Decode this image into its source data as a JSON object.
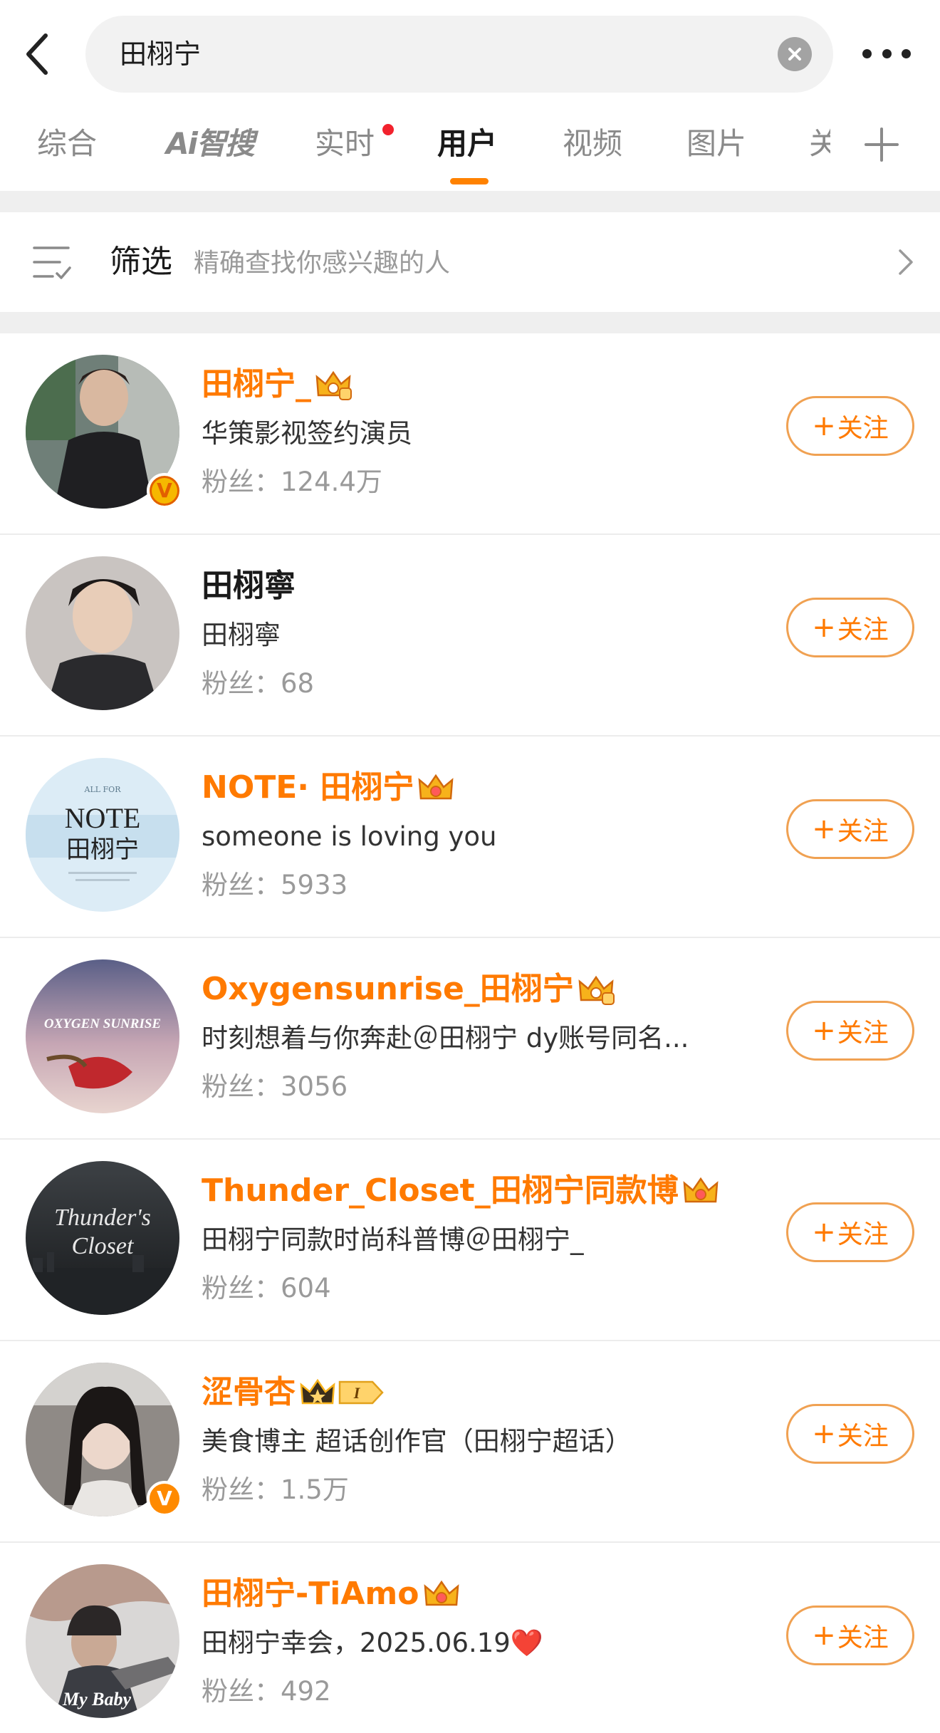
{
  "search": {
    "query": "田栩宁"
  },
  "tabs": [
    {
      "label": "综合"
    },
    {
      "label": "Ai智搜"
    },
    {
      "label": "实时"
    },
    {
      "label": "用户"
    },
    {
      "label": "视频"
    },
    {
      "label": "图片"
    },
    {
      "label": "关"
    }
  ],
  "active_tab": "用户",
  "filter": {
    "title": "筛选",
    "subtitle": "精确查找你感兴趣的人"
  },
  "follow_label": "关注",
  "fans_prefix": "粉丝：",
  "users": [
    {
      "name": "田栩宁_",
      "desc": "华策影视签约演员",
      "fans": "124.4万",
      "verified": "gold",
      "crown": true
    },
    {
      "name": "田栩寧",
      "desc": "田栩寧",
      "fans": "68",
      "verified": "none",
      "crown": false
    },
    {
      "name": "NOTE· 田栩宁",
      "desc": "someone is loving you",
      "fans": "5933",
      "verified": "none",
      "crown": true
    },
    {
      "name": "Oxygensunrise_田栩宁",
      "desc": "时刻想着与你奔赴＠田栩宁 dy账号同名...",
      "fans": "3056",
      "verified": "none",
      "crown": true
    },
    {
      "name": "Thunder_Closet_田栩宁同款博",
      "desc": "田栩宁同款时尚科普博＠田栩宁_",
      "fans": "604",
      "verified": "none",
      "crown": true
    },
    {
      "name": "涩骨杏",
      "desc": "美食博主 超话创作官（田栩宁超话）",
      "fans": "1.5万",
      "verified": "orange",
      "crown": true,
      "level": "I"
    },
    {
      "name": "田栩宁-TiAmo",
      "desc": "田栩宁幸会，2025.06.19",
      "fans": "492",
      "verified": "none",
      "crown": true,
      "desc_emoji": "❤️"
    }
  ],
  "avatar_text": {
    "note_small": "ALL FOR",
    "note_big": "NOTE",
    "note_cn": "田栩宁",
    "oxygen": "OXYGEN SUNRISE",
    "thunder_1": "Thunder's",
    "thunder_2": "Closet",
    "tiamo": "My Baby"
  },
  "colors": {
    "accent": "#ff7a00",
    "follow_border": "#f0a152",
    "tab_dot": "#f2222d",
    "bg_gap": "#efefef"
  },
  "icons": [
    "back-arrow-icon",
    "clear-icon",
    "more-dots-icon",
    "plus-icon",
    "filter-icon",
    "chevron-right-icon",
    "crown-icon",
    "verified-icon"
  ]
}
